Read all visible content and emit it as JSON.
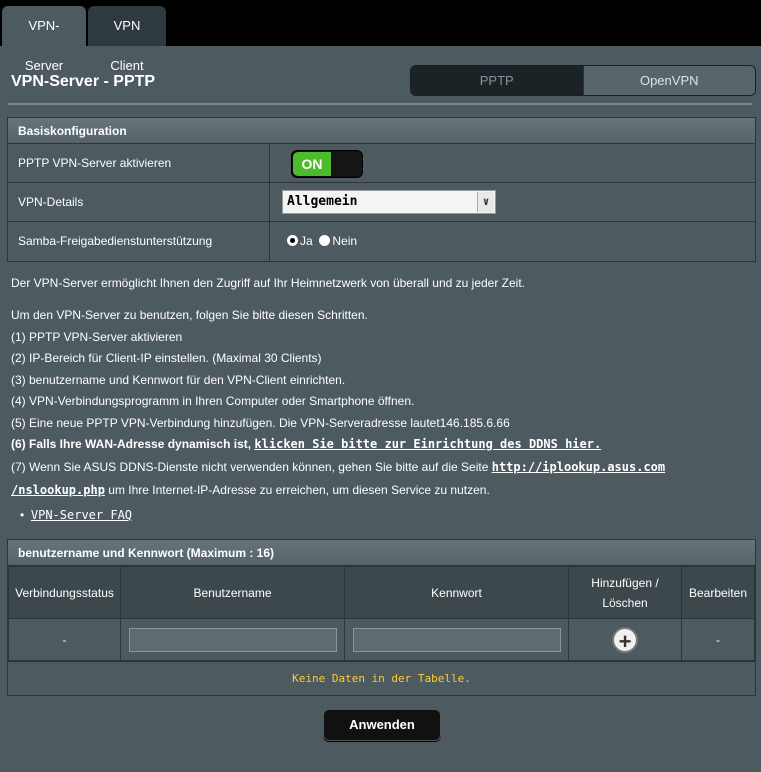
{
  "tabs": [
    {
      "label": "VPN-Server",
      "active": true
    },
    {
      "label": "VPN Client",
      "active": false
    }
  ],
  "page_title": "VPN-Server - PPTP",
  "protocol_switch": {
    "options": [
      "PPTP",
      "OpenVPN"
    ],
    "selected": "PPTP"
  },
  "basic": {
    "header": "Basiskonfiguration",
    "rows": {
      "enable_label": "PPTP VPN-Server aktivieren",
      "enable_state": "ON",
      "details_label": "VPN-Details",
      "details_value": "Allgemein",
      "samba_label": "Samba-Freigabedienstunterstützung",
      "samba_yes": "Ja",
      "samba_no": "Nein",
      "samba_selected": "Ja"
    }
  },
  "description": {
    "intro": "Der VPN-Server ermöglicht Ihnen den Zugriff auf Ihr Heimnetzwerk von überall und zu jeder Zeit.",
    "steps_intro": "Um den VPN-Server zu benutzen, folgen Sie bitte diesen Schritten.",
    "step1": "(1) PPTP VPN-Server aktivieren",
    "step2": "(2) IP-Bereich für Client-IP einstellen. (Maximal 30 Clients)",
    "step3": "(3) benutzername und Kennwort für den VPN-Client einrichten.",
    "step4": "(4) VPN-Verbindungsprogramm in Ihren Computer oder Smartphone öffnen.",
    "step5": "(5) Eine neue PPTP VPN-Verbindung hinzufügen. Die VPN-Serveradresse lautet146.185.6.66",
    "step6_text": "(6) Falls Ihre WAN-Adresse dynamisch ist,",
    "step6_link": "klicken Sie bitte zur Einrichtung des DDNS hier.",
    "step7_text": "(7) Wenn Sie ASUS DDNS-Dienste nicht verwenden können, gehen Sie bitte auf die Seite",
    "step7_link_a": "http://iplookup.asus.com",
    "step7_link_b": "/nslookup.php",
    "step7_rest": "um Ihre Internet-IP-Adresse zu erreichen, um diesen Service zu nutzen.",
    "faq_link": "VPN-Server FAQ"
  },
  "users": {
    "header": "benutzername und Kennwort (Maximum : 16)",
    "columns": [
      "Verbindungsstatus",
      "Benutzername",
      "Kennwort",
      "Hinzufügen / Löschen",
      "Bearbeiten"
    ],
    "input_row": {
      "status": "-",
      "edit": "-"
    },
    "empty_text": "Keine Daten in der Tabelle."
  },
  "apply_label": "Anwenden"
}
